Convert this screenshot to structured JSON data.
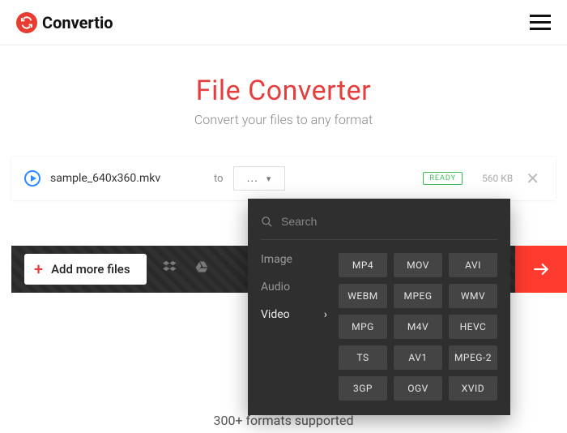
{
  "brand": {
    "name": "Convertio"
  },
  "hero": {
    "title": "File Converter",
    "subtitle": "Convert your files to any format"
  },
  "file": {
    "name": "sample_640x360.mkv",
    "to_label": "to",
    "select_placeholder": "...",
    "status": "READY",
    "size": "560 KB"
  },
  "actions": {
    "add_more": "Add more files"
  },
  "dropdown": {
    "search_placeholder": "Search",
    "categories": {
      "image": "Image",
      "audio": "Audio",
      "video": "Video"
    },
    "video_formats": [
      "MP4",
      "MOV",
      "AVI",
      "WEBM",
      "MPEG",
      "WMV",
      "MPG",
      "M4V",
      "HEVC",
      "TS",
      "AV1",
      "MPEG-2",
      "3GP",
      "OGV",
      "XVID"
    ]
  },
  "feature": {
    "formats_supported": "300+ formats supported"
  }
}
